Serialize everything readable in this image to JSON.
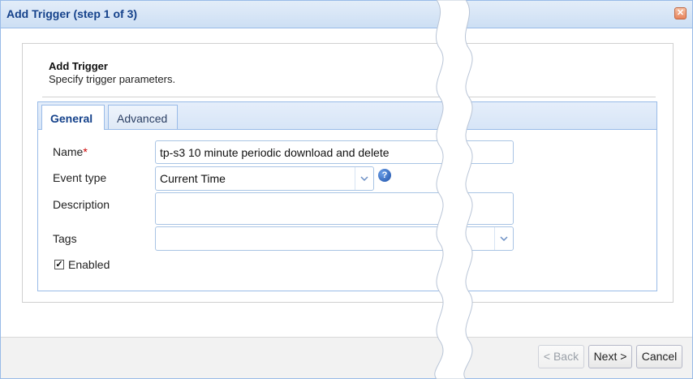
{
  "dialog": {
    "title": "Add Trigger (step 1 of 3)",
    "close_icon": "close-icon"
  },
  "header": {
    "title": "Add Trigger",
    "subtitle": "Specify trigger parameters."
  },
  "tabs": [
    {
      "label": "General",
      "active": true
    },
    {
      "label": "Advanced",
      "active": false
    }
  ],
  "form": {
    "name_label": "Name",
    "required_mark": "*",
    "name_value": "tp-s3 10 minute periodic download and delete",
    "event_type_label": "Event type",
    "event_type_value": "Current Time",
    "help_icon": "help-icon",
    "description_label": "Description",
    "description_value": "",
    "tags_label": "Tags",
    "tags_value": "",
    "enabled_label": "Enabled",
    "enabled_checked": true
  },
  "footer": {
    "back_label": "< Back",
    "next_label": "Next >",
    "cancel_label": "Cancel"
  },
  "colors": {
    "accent": "#15428b",
    "border": "#99bbe8",
    "required": "#cc0000"
  }
}
